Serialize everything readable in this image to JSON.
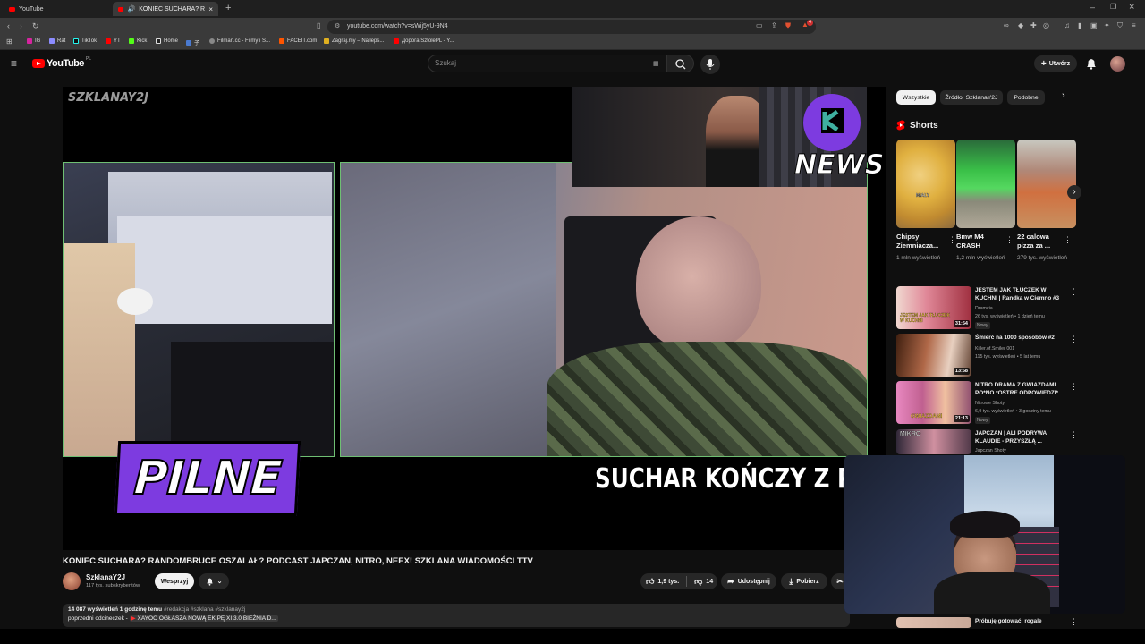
{
  "browser": {
    "tabs": [
      {
        "label": "YouTube"
      },
      {
        "label": "KONIEC SUCHARA? RANDOM"
      }
    ],
    "url": "youtube.com/watch?v=sWij5yU-9N4",
    "bookmarks": [
      "IG",
      "Rat",
      "TikTok",
      "YT",
      "Kick",
      "Home",
      "子",
      "Filman.cc - Filmy i S...",
      "FACEIT.com",
      "Zagraj.my – Najleps...",
      "Дорога SztolePL - Y..."
    ],
    "extension_badge": "4"
  },
  "header": {
    "logo": "YouTube",
    "logo_country": "PL",
    "search_placeholder": "Szukaj",
    "create_label": "Utwórz"
  },
  "video": {
    "corner_logo": "SZKLANAY2J",
    "news_label": "NEWS",
    "pilne": "PILNE",
    "ticker": "SUCHAR KOŃCZY Z PR"
  },
  "meta": {
    "title": "KONIEC SUCHARA? RANDOMBRUCE OSZALAŁ? PODCAST JAPCZAN, NITRO, NEEX! SZKLANA WIADOMOŚCI TTV",
    "channel": "SzklanaY2J",
    "subscribers": "117 tys. subskrybentów",
    "support_label": "Wesprzyj",
    "likes": "1,9 tys.",
    "dislikes": "14",
    "share_label": "Udostępnij",
    "download_label": "Pobierz",
    "views_line": "14 087 wyświetleń  1 godzinę temu",
    "hashtags": "#redakcja #szklana #szklanay2j",
    "prev_line_prefix": "poprzedni odcineczek -",
    "prev_line_link": "XAYOO OGŁASZA NOWĄ EKIPĘ XI 3.0  BIEŻNIA D..."
  },
  "sidebar": {
    "chips": [
      "Wszystkie",
      "Źródło: SzklanaY2J",
      "Podobne"
    ],
    "shorts_heading": "Shorts",
    "shorts": [
      {
        "title": "Chipsy Ziemniacza...",
        "views": "1 mln wyświetleń"
      },
      {
        "title": "Bmw M4 CRASH",
        "views": "1,2 mln wyświetleń"
      },
      {
        "title": "22 calowa pizza za ...",
        "views": "279 tys. wyświetleń"
      }
    ],
    "recs": [
      {
        "title": "JESTEM JAK TŁUCZEK W KUCHNI | Randka w Ciemno #3",
        "channel": "Dramcia",
        "meta": "26 tys. wyświetleń • 1 dzień temu",
        "badge": "Nowy",
        "duration": "31:54"
      },
      {
        "title": "Śmierć na 1000 sposobów #2",
        "channel": "Killer.of.Smiler 001",
        "meta": "115 tys. wyświetleń • 5 lat temu",
        "badge": "",
        "duration": "13:58"
      },
      {
        "title": "NITRO DRAMA Z GWIAZDAMI PO*NO *OSTRE ODPOWIEDZI*",
        "channel": "Nitrowe Shoty",
        "meta": "6,9 tys. wyświetleń • 3 godziny temu",
        "badge": "Nowy",
        "duration": "21:13"
      },
      {
        "title": "JAPCZAN | ALI PODRYWA KLAUDIE - PRZYSZŁĄ ...",
        "channel": "Japczan Shoty",
        "meta": "",
        "badge": "",
        "duration": ""
      },
      {
        "title": "Próbuję gotować: rogale",
        "channel": "",
        "meta": "",
        "badge": "",
        "duration": ""
      }
    ]
  },
  "thumb_text": {
    "rec1": "JESTEM JAK TŁUCZEK W KUCHNI",
    "rec3": "GWIAZDAMI",
    "rec4": "MIKRO",
    "short1": "MIALY"
  },
  "colors": {
    "accent": "#ff0000",
    "pilne_purple": "#7d3be0",
    "cam_border": "#6fbf73",
    "news_teal": "#3fb0a0"
  }
}
